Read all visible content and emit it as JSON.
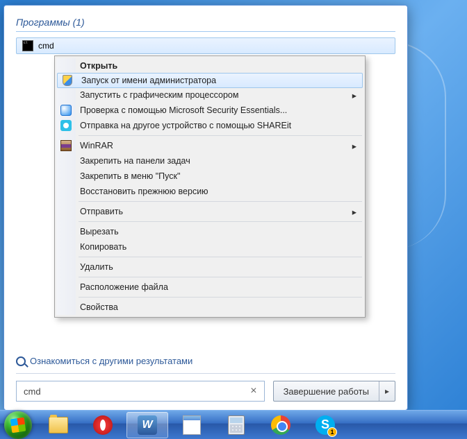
{
  "start_menu": {
    "programs_header": "Программы (1)",
    "result_label": "cmd",
    "other_results": "Ознакомиться с другими результатами",
    "search_value": "cmd",
    "shutdown_label": "Завершение работы"
  },
  "context_menu": {
    "open": "Открыть",
    "run_as_admin": "Запуск от имени администратора",
    "run_with_gpu": "Запустить с графическим процессором",
    "mse_scan": "Проверка с помощью Microsoft Security Essentials...",
    "shareit": "Отправка на другое устройство с помощью SHAREit",
    "winrar": "WinRAR",
    "pin_taskbar": "Закрепить на панели задач",
    "pin_start": "Закрепить в меню \"Пуск\"",
    "restore_prev": "Восстановить прежнюю версию",
    "send_to": "Отправить",
    "cut": "Вырезать",
    "copy": "Копировать",
    "delete": "Удалить",
    "file_location": "Расположение файла",
    "properties": "Свойства"
  },
  "taskbar": {
    "word_letter": "W",
    "skype_letter": "S",
    "skype_badge": "1"
  }
}
